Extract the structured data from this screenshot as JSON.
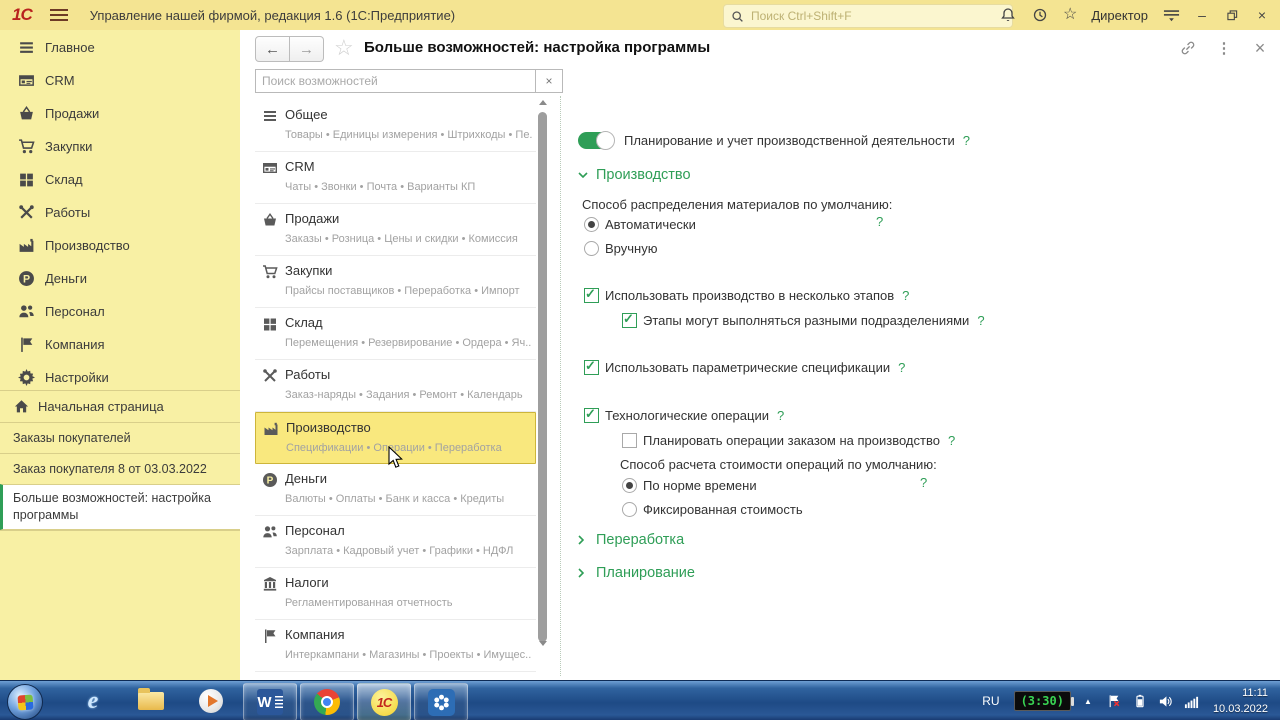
{
  "titlebar": {
    "logo": "1С",
    "title": "Управление нашей фирмой, редакция 1.6  (1С:Предприятие)",
    "search_placeholder": "Поиск Ctrl+Shift+F",
    "user": "Директор",
    "icons": [
      "notifications-icon",
      "history-icon",
      "favorites-icon",
      "service-menu-icon",
      "minimize-icon",
      "restore-icon",
      "close-icon"
    ],
    "favorites_glyph": "☆",
    "minimize_glyph": "–",
    "close_glyph": "×"
  },
  "sidebar": {
    "nav": [
      {
        "label": "Главное",
        "icon": "menu-icon"
      },
      {
        "label": "CRM",
        "icon": "crm-icon"
      },
      {
        "label": "Продажи",
        "icon": "sales-icon"
      },
      {
        "label": "Закупки",
        "icon": "purchases-icon"
      },
      {
        "label": "Склад",
        "icon": "warehouse-icon"
      },
      {
        "label": "Работы",
        "icon": "works-icon"
      },
      {
        "label": "Производство",
        "icon": "production-icon"
      },
      {
        "label": "Деньги",
        "icon": "money-icon"
      },
      {
        "label": "Персонал",
        "icon": "staff-icon"
      },
      {
        "label": "Компания",
        "icon": "company-icon"
      },
      {
        "label": "Настройки",
        "icon": "settings-icon"
      }
    ],
    "home": {
      "label": "Начальная страница",
      "icon": "home-icon"
    },
    "windows": [
      {
        "label": "Заказы покупателей",
        "active": false
      },
      {
        "label": "Заказ покупателя 8 от 03.03.2022",
        "active": false
      },
      {
        "label": "Больше возможностей: настройка программы",
        "active": true
      }
    ]
  },
  "panel": {
    "title": "Больше возможностей: настройка программы",
    "back_glyph": "←",
    "forward_glyph": "→",
    "favorite_glyph": "☆",
    "more_glyph": "⋮",
    "close_glyph": "×",
    "search_placeholder": "Поиск возможностей",
    "search_clear_glyph": "×",
    "categories": [
      {
        "label": "Общее",
        "icon": "menu-icon",
        "sub": "Товары • Единицы измерения • Штрихкоды • Пе...",
        "selected": false
      },
      {
        "label": "CRM",
        "icon": "crm-icon",
        "sub": "Чаты • Звонки • Почта • Варианты КП",
        "selected": false
      },
      {
        "label": "Продажи",
        "icon": "sales-icon",
        "sub": "Заказы • Розница • Цены и скидки • Комиссия",
        "selected": false
      },
      {
        "label": "Закупки",
        "icon": "purchases-icon",
        "sub": "Прайсы поставщиков • Переработка • Импорт",
        "selected": false
      },
      {
        "label": "Склад",
        "icon": "warehouse-icon",
        "sub": "Перемещения • Резервирование • Ордера • Яч...",
        "selected": false
      },
      {
        "label": "Работы",
        "icon": "works-icon",
        "sub": "Заказ-наряды • Задания • Ремонт • Календарь",
        "selected": false
      },
      {
        "label": "Производство",
        "icon": "production-icon",
        "sub": "Спецификации • Операции • Переработка",
        "selected": true
      },
      {
        "label": "Деньги",
        "icon": "money-icon",
        "sub": "Валюты • Оплаты • Банк и касса • Кредиты",
        "selected": false
      },
      {
        "label": "Персонал",
        "icon": "staff-icon",
        "sub": "Зарплата • Кадровый учет • Графики • НДФЛ",
        "selected": false
      },
      {
        "label": "Налоги",
        "icon": "taxes-icon",
        "sub": "Регламентированная отчетность",
        "selected": false
      },
      {
        "label": "Компания",
        "icon": "company-icon",
        "sub": "Интеркампани • Магазины • Проекты • Имущес...",
        "selected": false
      }
    ],
    "settings": {
      "master_toggle": {
        "label": "Планирование и учет производственной деятельности",
        "on": true,
        "help": "?"
      },
      "section_production": {
        "label": "Производство",
        "expanded": true
      },
      "materials_group": {
        "label": "Способ распределения материалов по умолчанию:",
        "help": "?",
        "options": [
          {
            "label": "Автоматически",
            "selected": true
          },
          {
            "label": "Вручную",
            "selected": false
          }
        ]
      },
      "multi_stage": {
        "label": "Использовать производство в несколько этапов",
        "checked": true,
        "help": "?"
      },
      "stages_departments": {
        "label": "Этапы могут выполняться разными подразделениями",
        "checked": true,
        "help": "?"
      },
      "parametric_specs": {
        "label": "Использовать параметрические спецификации",
        "checked": true,
        "help": "?"
      },
      "tech_operations": {
        "label": "Технологические операции",
        "checked": true,
        "help": "?"
      },
      "plan_operations": {
        "label": "Планировать операции заказом на производство",
        "checked": false,
        "help": "?"
      },
      "cost_group": {
        "label": "Способ расчета стоимости операций по умолчанию:",
        "help": "?",
        "options": [
          {
            "label": "По норме времени",
            "selected": true
          },
          {
            "label": "Фиксированная стоимость",
            "selected": false
          }
        ]
      },
      "section_processing": {
        "label": "Переработка",
        "expanded": false
      },
      "section_planning": {
        "label": "Планирование",
        "expanded": false
      }
    }
  },
  "taskbar": {
    "quick_launch": [
      {
        "icon": "ie-icon"
      },
      {
        "icon": "explorer-icon"
      },
      {
        "icon": "media-player-icon"
      }
    ],
    "open_apps": [
      {
        "icon": "word-icon"
      },
      {
        "icon": "chrome-icon"
      },
      {
        "icon": "1c-icon",
        "active": true
      },
      {
        "icon": "teamwork-icon"
      }
    ],
    "tray": {
      "language": "RU",
      "timer": "(3:30)",
      "hidden_glyph": "▲",
      "icons": [
        "hidden-icons-icon",
        "action-center-icon",
        "battery-icon",
        "volume-icon",
        "network-icon"
      ],
      "time": "11:11",
      "date": "10.03.2022"
    },
    "word_glyph": "W",
    "onec_glyph": "1С",
    "ie_glyph": "e"
  }
}
